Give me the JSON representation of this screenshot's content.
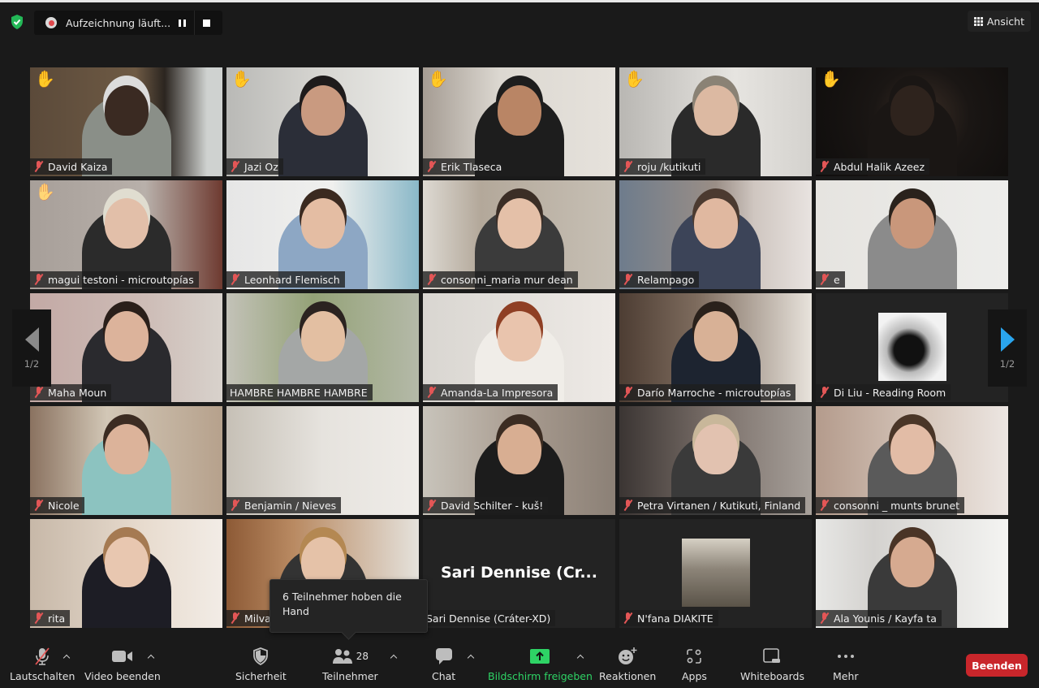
{
  "top_bar": {
    "security_icon": "shield-check-icon",
    "recording": {
      "status": "Aufzeichnung läuft...",
      "pause_icon": "pause-icon",
      "stop_icon": "stop-icon"
    },
    "view_button": {
      "label": "Ansicht",
      "icon": "grid-icon"
    }
  },
  "colors": {
    "background": "#1a1a1a",
    "active_speaker_border": "#e5ea7a",
    "muted_icon": "#e35656",
    "raised_hand": "#f4c02e",
    "share_green": "#2ed365",
    "end_button": "#c9262b",
    "nav_arrow_active": "#2aa5ee"
  },
  "pagination": {
    "previous_label": "1/2",
    "next_label": "1/2"
  },
  "participants": [
    {
      "name": "David Kaiza",
      "muted": true,
      "hand_raised": true,
      "video": true
    },
    {
      "name": "Jazi Oz",
      "muted": true,
      "hand_raised": true,
      "video": true
    },
    {
      "name": "Erik Tlaseca",
      "muted": true,
      "hand_raised": true,
      "video": true
    },
    {
      "name": "roju /kutikuti",
      "muted": true,
      "hand_raised": true,
      "video": true
    },
    {
      "name": "Abdul Halik Azeez",
      "muted": true,
      "hand_raised": true,
      "video": true
    },
    {
      "name": "magui testoni - microutopías",
      "muted": true,
      "hand_raised": true,
      "video": true
    },
    {
      "name": "Leonhard Flemisch",
      "muted": true,
      "hand_raised": false,
      "video": true
    },
    {
      "name": "consonni_maria mur dean",
      "muted": true,
      "hand_raised": false,
      "video": true
    },
    {
      "name": "Relampago",
      "muted": true,
      "hand_raised": false,
      "video": true
    },
    {
      "name": "e",
      "muted": true,
      "hand_raised": false,
      "video": true
    },
    {
      "name": "Maha Moun",
      "muted": true,
      "hand_raised": false,
      "video": true
    },
    {
      "name": "HAMBRE HAMBRE HAMBRE",
      "muted": false,
      "hand_raised": false,
      "video": true,
      "active_speaker": true
    },
    {
      "name": "Amanda-La Impresora",
      "muted": true,
      "hand_raised": false,
      "video": true
    },
    {
      "name": "Darío Marroche - microutopías",
      "muted": true,
      "hand_raised": false,
      "video": true
    },
    {
      "name": "Di Liu - Reading Room",
      "muted": true,
      "hand_raised": false,
      "video": false,
      "profile_picture": true
    },
    {
      "name": "Nicole",
      "muted": true,
      "hand_raised": false,
      "video": true
    },
    {
      "name": "Benjamin / Nieves",
      "muted": true,
      "hand_raised": false,
      "video": true
    },
    {
      "name": "David Schilter - kuš!",
      "muted": true,
      "hand_raised": false,
      "video": true
    },
    {
      "name": "Petra Virtanen / Kutikuti, Finland",
      "muted": true,
      "hand_raised": false,
      "video": true
    },
    {
      "name": "consonni _ munts brunet",
      "muted": true,
      "hand_raised": false,
      "video": true
    },
    {
      "name": "rita",
      "muted": true,
      "hand_raised": false,
      "video": true
    },
    {
      "name": "Milva",
      "muted": true,
      "hand_raised": false,
      "video": true
    },
    {
      "name": "Sari Dennise (Cráter-XD)",
      "display_title": "Sari Dennise (Cr...",
      "muted": false,
      "hand_raised": false,
      "video": false
    },
    {
      "name": "N'fana DIAKITE",
      "muted": true,
      "hand_raised": false,
      "video": false,
      "profile_picture": true
    },
    {
      "name": "Ala Younis / Kayfa ta",
      "muted": true,
      "hand_raised": false,
      "video": true
    }
  ],
  "tooltip": {
    "text": "6 Teilnehmer hoben die Hand"
  },
  "toolbar": {
    "mute": {
      "label": "Lautschalten",
      "icon": "microphone-muted-icon"
    },
    "video": {
      "label": "Video beenden",
      "icon": "video-camera-icon"
    },
    "security": {
      "label": "Sicherheit",
      "icon": "shield-icon"
    },
    "participants": {
      "label": "Teilnehmer",
      "icon": "participants-icon",
      "count": "28"
    },
    "chat": {
      "label": "Chat",
      "icon": "chat-bubble-icon"
    },
    "share": {
      "label": "Bildschirm freigeben",
      "icon": "share-screen-icon"
    },
    "reactions": {
      "label": "Reaktionen",
      "icon": "emoji-add-icon"
    },
    "apps": {
      "label": "Apps",
      "icon": "apps-icon"
    },
    "whiteboards": {
      "label": "Whiteboards",
      "icon": "whiteboard-icon"
    },
    "more": {
      "label": "Mehr",
      "icon": "more-dots-icon"
    },
    "end": {
      "label": "Beenden"
    }
  }
}
